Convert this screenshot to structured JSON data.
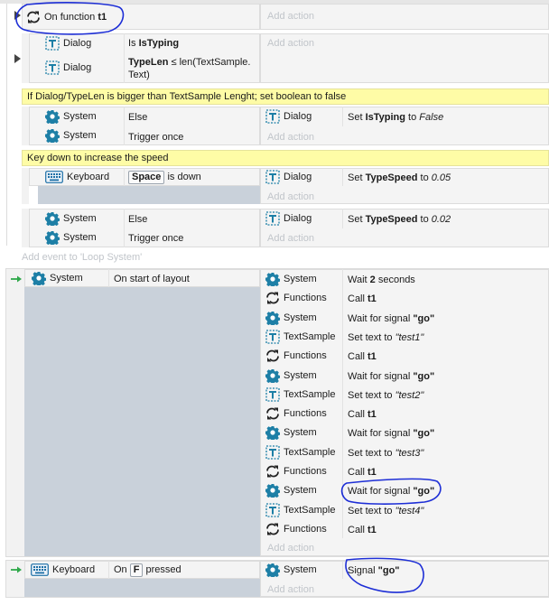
{
  "func_event": {
    "condition_text": "On function ",
    "function_name": "t1",
    "add_action": "Add action"
  },
  "sub_event_1": {
    "conditions": [
      {
        "object": "Dialog",
        "text": "Is ",
        "bold": "IsTyping"
      },
      {
        "object": "Dialog",
        "bold": "TypeLen",
        "text": " ≤ len(TextSample.",
        "text2": "Text)"
      }
    ],
    "add_action": "Add action"
  },
  "comment_1": "If Dialog/TypeLen is bigger than TextSample Lenght; set boolean to false",
  "sub_event_2": {
    "conditions": [
      {
        "object": "System",
        "text": "Else"
      },
      {
        "object": "System",
        "text": "Trigger once"
      }
    ],
    "action": {
      "object": "Dialog",
      "text": "Set ",
      "bold": "IsTyping",
      "to": " to ",
      "value": "False"
    },
    "add_action": "Add action"
  },
  "comment_2": "Key down to increase the speed",
  "sub_event_3": {
    "condition": {
      "object": "Keyboard",
      "key": "Space",
      "text": " is down"
    },
    "action": {
      "object": "Dialog",
      "text": "Set ",
      "bold": "TypeSpeed",
      "to": " to ",
      "value": "0.05"
    },
    "add_action": "Add action"
  },
  "sub_event_4": {
    "conditions": [
      {
        "object": "System",
        "text": "Else"
      },
      {
        "object": "System",
        "text": "Trigger once"
      }
    ],
    "action": {
      "object": "Dialog",
      "text": "Set ",
      "bold": "TypeSpeed",
      "to": " to ",
      "value": "0.02"
    },
    "add_action": "Add action"
  },
  "add_event": "Add event to 'Loop System'",
  "layout_event": {
    "condition": {
      "object": "System",
      "text": "On start of layout"
    },
    "actions": [
      {
        "object": "System",
        "icon": "gear",
        "pre": "Wait ",
        "bold": "2",
        "post": " seconds",
        "ital": ""
      },
      {
        "object": "Functions",
        "icon": "func",
        "pre": "Call ",
        "bold": "t1",
        "post": "",
        "ital": ""
      },
      {
        "object": "System",
        "icon": "gear",
        "pre": "Wait for signal ",
        "bold": "\"go\"",
        "post": "",
        "ital": ""
      },
      {
        "object": "TextSample",
        "icon": "text",
        "pre": "Set text to ",
        "bold": "",
        "post": "",
        "ital": "\"test1\""
      },
      {
        "object": "Functions",
        "icon": "func",
        "pre": "Call ",
        "bold": "t1",
        "post": "",
        "ital": ""
      },
      {
        "object": "System",
        "icon": "gear",
        "pre": "Wait for signal ",
        "bold": "\"go\"",
        "post": "",
        "ital": ""
      },
      {
        "object": "TextSample",
        "icon": "text",
        "pre": "Set text to ",
        "bold": "",
        "post": "",
        "ital": "\"test2\""
      },
      {
        "object": "Functions",
        "icon": "func",
        "pre": "Call ",
        "bold": "t1",
        "post": "",
        "ital": ""
      },
      {
        "object": "System",
        "icon": "gear",
        "pre": "Wait for signal ",
        "bold": "\"go\"",
        "post": "",
        "ital": ""
      },
      {
        "object": "TextSample",
        "icon": "text",
        "pre": "Set text to ",
        "bold": "",
        "post": "",
        "ital": "\"test3\""
      },
      {
        "object": "Functions",
        "icon": "func",
        "pre": "Call ",
        "bold": "t1",
        "post": "",
        "ital": ""
      },
      {
        "object": "System",
        "icon": "gear",
        "pre": "Wait for signal ",
        "bold": "\"go\"",
        "post": "",
        "ital": ""
      },
      {
        "object": "TextSample",
        "icon": "text",
        "pre": "Set text to ",
        "bold": "",
        "post": "",
        "ital": "\"test4\""
      },
      {
        "object": "Functions",
        "icon": "func",
        "pre": "Call ",
        "bold": "t1",
        "post": "",
        "ital": ""
      }
    ],
    "add_action": "Add action"
  },
  "keyboard_event": {
    "condition": {
      "object": "Keyboard",
      "pre": "On ",
      "key": "F",
      "post": " pressed"
    },
    "action": {
      "object": "System",
      "pre": "Signal ",
      "bold": "\"go\""
    },
    "add_action": "Add action"
  },
  "colors": {
    "system_icon": "#1d7fa6",
    "comment_bg": "#fefca6",
    "annotation": "#1d2ed6",
    "event_arrow": "#2fa84a"
  },
  "icons": [
    "gear-icon",
    "function-icon",
    "text-object-icon",
    "keyboard-icon",
    "event-arrow-icon",
    "expand-triangle-icon"
  ]
}
